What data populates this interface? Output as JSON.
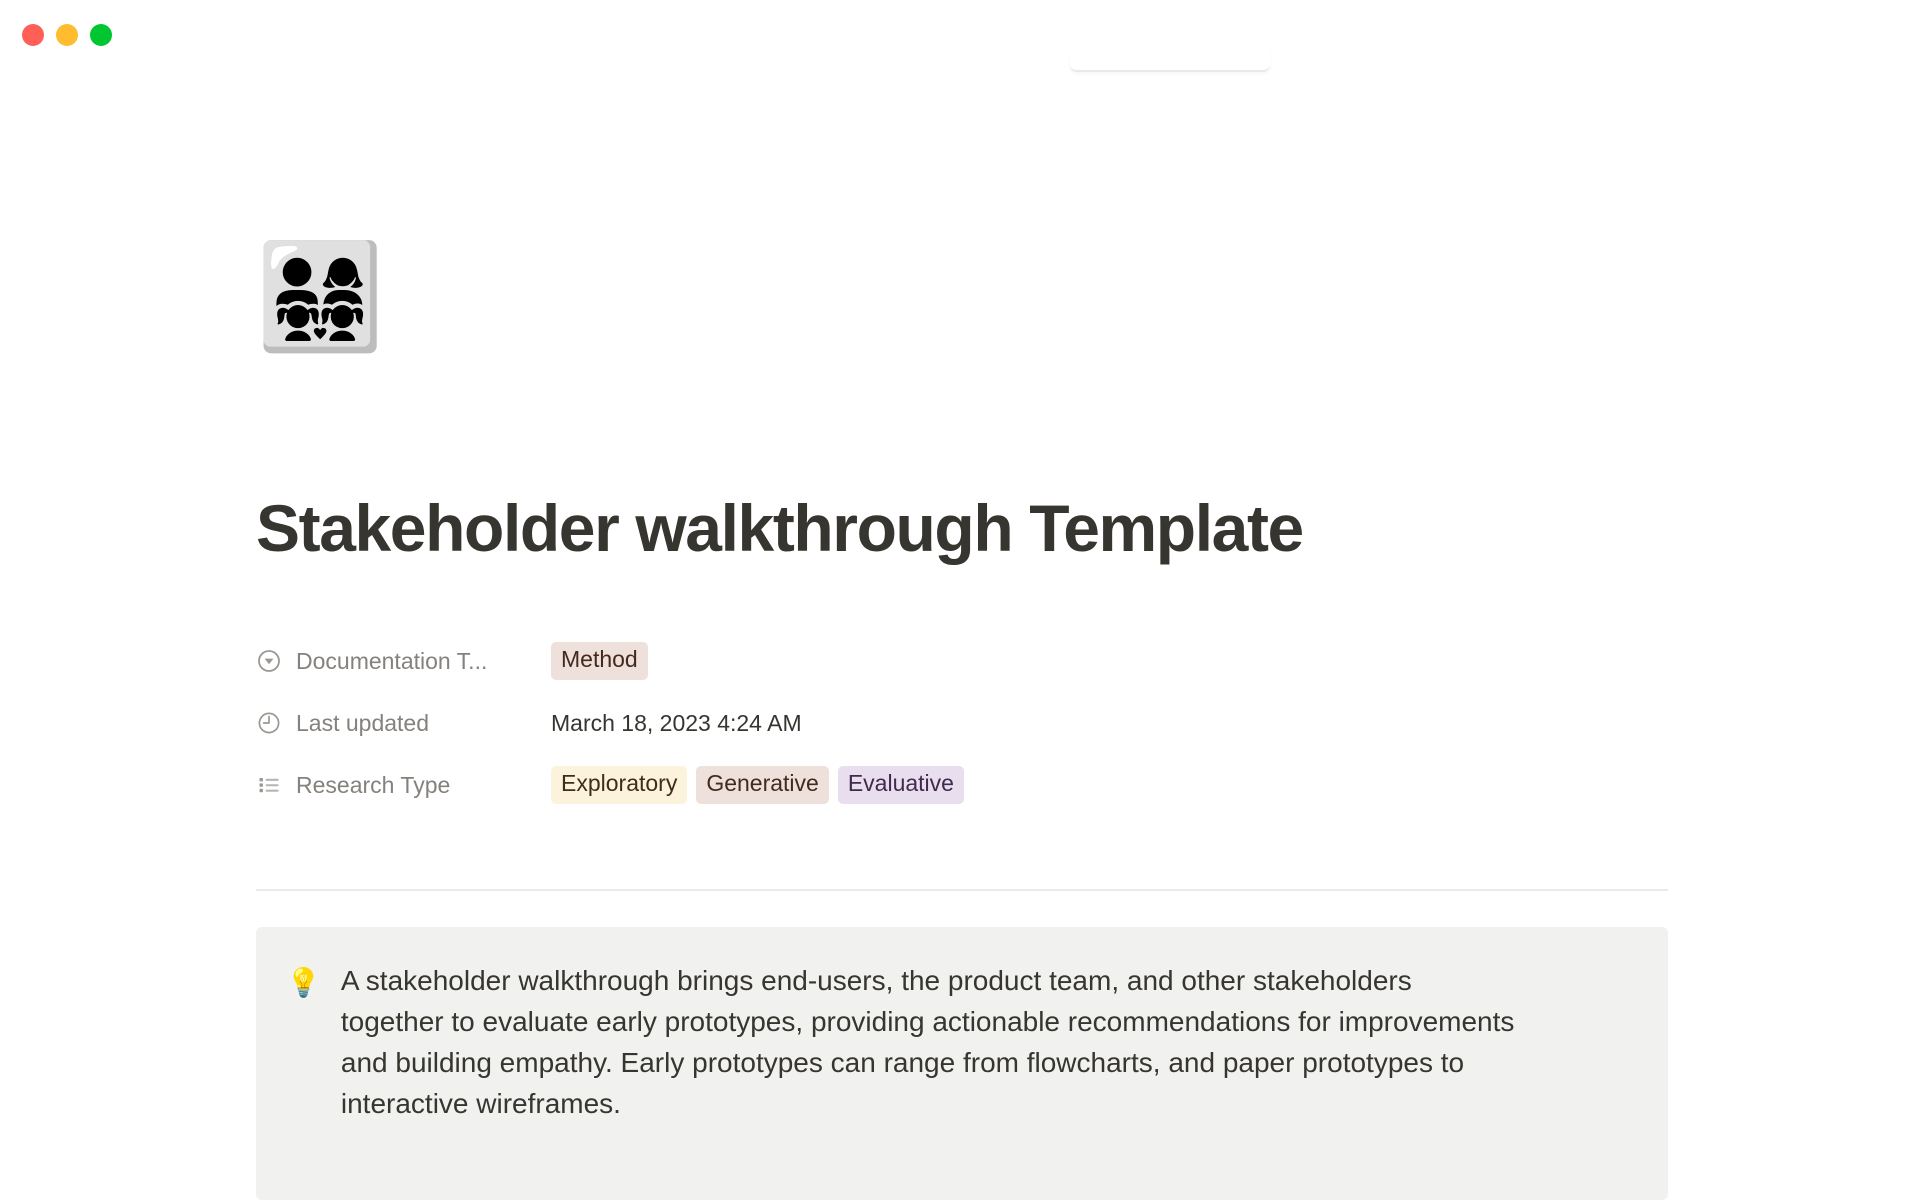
{
  "window": {
    "traffic_lights": [
      {
        "name": "close",
        "color": "#FF5F57"
      },
      {
        "name": "minimize",
        "color": "#FEBC2E"
      },
      {
        "name": "maximize",
        "color": "#00C731"
      }
    ]
  },
  "page": {
    "emoji": "👨‍👩‍👧‍👧",
    "emoji_name": "family-man-woman-girl-girl",
    "title": "Stakeholder walkthrough Template",
    "title_color": "#37352F"
  },
  "properties": [
    {
      "icon": "select-chevron-circle-icon",
      "label": "Documentation T...",
      "type": "select",
      "tags": [
        {
          "text": "Method",
          "bg": "#EEE0DA",
          "fg": "#442A1E",
          "class": "tag-brown"
        }
      ]
    },
    {
      "icon": "clock-icon",
      "label": "Last updated",
      "type": "date",
      "value": "March 18, 2023 4:24 AM"
    },
    {
      "icon": "multi-select-list-icon",
      "label": "Research Type",
      "type": "multi_select",
      "tags": [
        {
          "text": "Exploratory",
          "bg": "#FBF3DB",
          "fg": "#402C1B",
          "class": "tag-yellow"
        },
        {
          "text": "Generative",
          "bg": "#EEE0DA",
          "fg": "#442A1E",
          "class": "tag-brown"
        },
        {
          "text": "Evaluative",
          "bg": "#E8DEEE",
          "fg": "#412A4D",
          "class": "tag-purple"
        }
      ]
    }
  ],
  "callout": {
    "emoji": "💡",
    "emoji_name": "light-bulb",
    "background": "#F1F1EF",
    "text": "A stakeholder walkthrough brings end-users, the product team, and other stakeholders together to evaluate early prototypes, providing actionable recommendations for improvements and building empathy. Early prototypes can range from flowcharts, and paper prototypes to interactive wireframes."
  }
}
